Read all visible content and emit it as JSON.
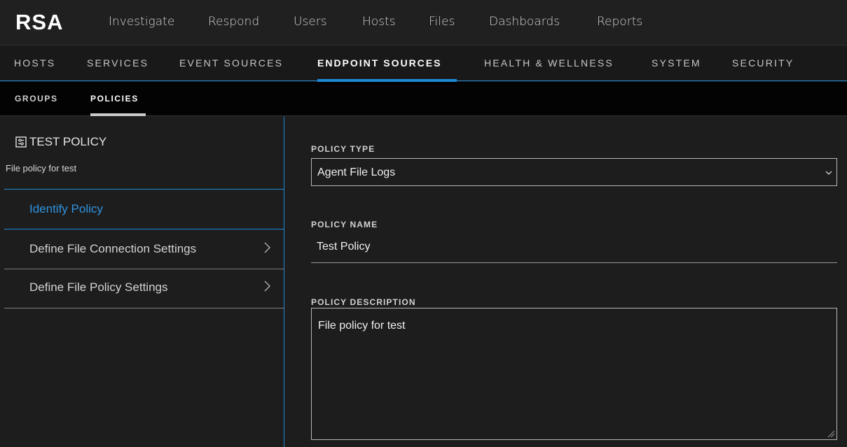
{
  "brand": {
    "logo_text": "RSA"
  },
  "topnav": [
    "Investigate",
    "Respond",
    "Users",
    "Hosts",
    "Files",
    "Dashboards",
    "Reports"
  ],
  "subnav": [
    "HOSTS",
    "SERVICES",
    "EVENT SOURCES",
    "ENDPOINT SOURCES",
    "HEALTH & WELLNESS",
    "SYSTEM",
    "SECURITY"
  ],
  "subnav_active": "ENDPOINT SOURCES",
  "tabs": [
    "GROUPS",
    "POLICIES"
  ],
  "tabs_active": "POLICIES",
  "policy": {
    "title": "TEST POLICY",
    "subtitle": "File policy for test"
  },
  "steps": [
    {
      "label": "Identify Policy",
      "active": true
    },
    {
      "label": "Define File Connection Settings",
      "active": false
    },
    {
      "label": "Define File Policy Settings",
      "active": false
    }
  ],
  "form": {
    "policy_type_label": "POLICY TYPE",
    "policy_type_value": "Agent File Logs",
    "policy_name_label": "POLICY NAME",
    "policy_name_value": "Test Policy",
    "policy_description_label": "POLICY DESCRIPTION",
    "policy_description_value": "File policy for test"
  },
  "colors": {
    "accent_blue": "#1e89d4",
    "active_step_text": "#2f93e0",
    "background": "#1d1d1d"
  },
  "icons": {
    "policy_icon": "policy-settings-icon",
    "step_chevron": "chevron-right-icon",
    "select_caret": "chevron-down-icon",
    "resize_grip": "resize-grip-icon"
  }
}
